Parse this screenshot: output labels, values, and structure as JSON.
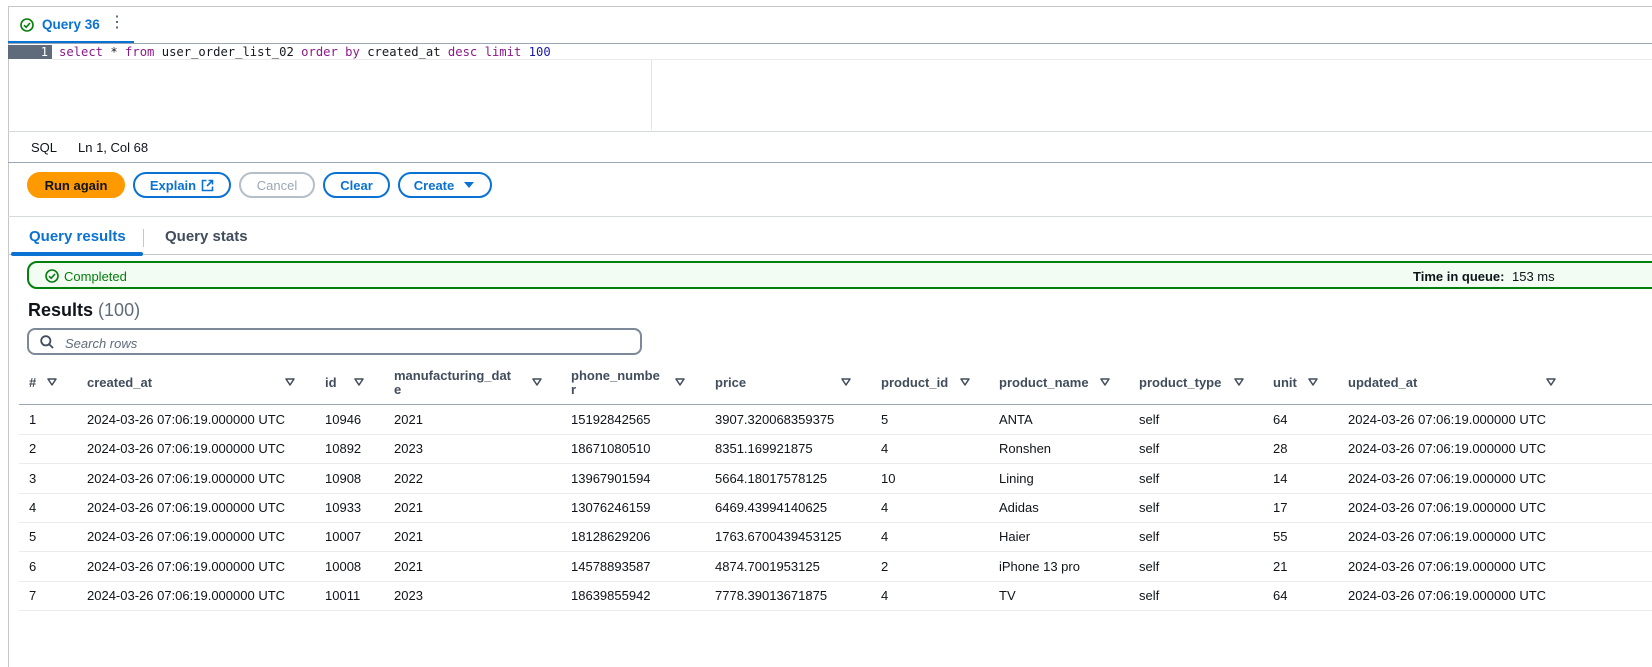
{
  "query_tab": {
    "name": "Query 36"
  },
  "editor": {
    "line_number": "1",
    "tokens": {
      "select": "select",
      "star": " * ",
      "from": "from",
      "table": " user_order_list_02 ",
      "order_by": "order by",
      "col": " created_at ",
      "desc": "desc",
      "limit": "limit",
      "limit_val": "100"
    }
  },
  "status": {
    "language": "SQL",
    "position": "Ln 1, Col 68"
  },
  "actions": {
    "run_again": "Run again",
    "explain": "Explain",
    "cancel": "Cancel",
    "clear": "Clear",
    "create": "Create"
  },
  "result_tabs": {
    "results": "Query results",
    "stats": "Query stats"
  },
  "alert": {
    "status": "Completed",
    "time_label": "Time in queue:",
    "time_value": "153 ms"
  },
  "results": {
    "title": "Results",
    "count": "(100)",
    "search_placeholder": "Search rows",
    "columns": [
      "#",
      "created_at",
      "id",
      "manufacturing_dat\ne",
      "phone_numbe\nr",
      "price",
      "product_id",
      "product_name",
      "product_type",
      "unit",
      "updated_at"
    ],
    "rows": [
      [
        "1",
        "2024-03-26 07:06:19.000000 UTC",
        "10946",
        "2021",
        "15192842565",
        "3907.320068359375",
        "5",
        "ANTA",
        "self",
        "64",
        "2024-03-26 07:06:19.000000 UTC"
      ],
      [
        "2",
        "2024-03-26 07:06:19.000000 UTC",
        "10892",
        "2023",
        "18671080510",
        "8351.169921875",
        "4",
        "Ronshen",
        "self",
        "28",
        "2024-03-26 07:06:19.000000 UTC"
      ],
      [
        "3",
        "2024-03-26 07:06:19.000000 UTC",
        "10908",
        "2022",
        "13967901594",
        "5664.18017578125",
        "10",
        "Lining",
        "self",
        "14",
        "2024-03-26 07:06:19.000000 UTC"
      ],
      [
        "4",
        "2024-03-26 07:06:19.000000 UTC",
        "10933",
        "2021",
        "13076246159",
        "6469.43994140625",
        "4",
        "Adidas",
        "self",
        "17",
        "2024-03-26 07:06:19.000000 UTC"
      ],
      [
        "5",
        "2024-03-26 07:06:19.000000 UTC",
        "10007",
        "2021",
        "18128629206",
        "1763.6700439453125",
        "4",
        "Haier",
        "self",
        "55",
        "2024-03-26 07:06:19.000000 UTC"
      ],
      [
        "6",
        "2024-03-26 07:06:19.000000 UTC",
        "10008",
        "2021",
        "14578893587",
        "4874.7001953125",
        "2",
        "iPhone 13 pro",
        "self",
        "21",
        "2024-03-26 07:06:19.000000 UTC"
      ],
      [
        "7",
        "2024-03-26 07:06:19.000000 UTC",
        "10011",
        "2023",
        "18639855942",
        "7778.39013671875",
        "4",
        "TV",
        "self",
        "64",
        "2024-03-26 07:06:19.000000 UTC"
      ]
    ]
  },
  "colors": {
    "accent": "#0972d3",
    "primary_button": "#ff9900",
    "success": "#037f0c"
  }
}
